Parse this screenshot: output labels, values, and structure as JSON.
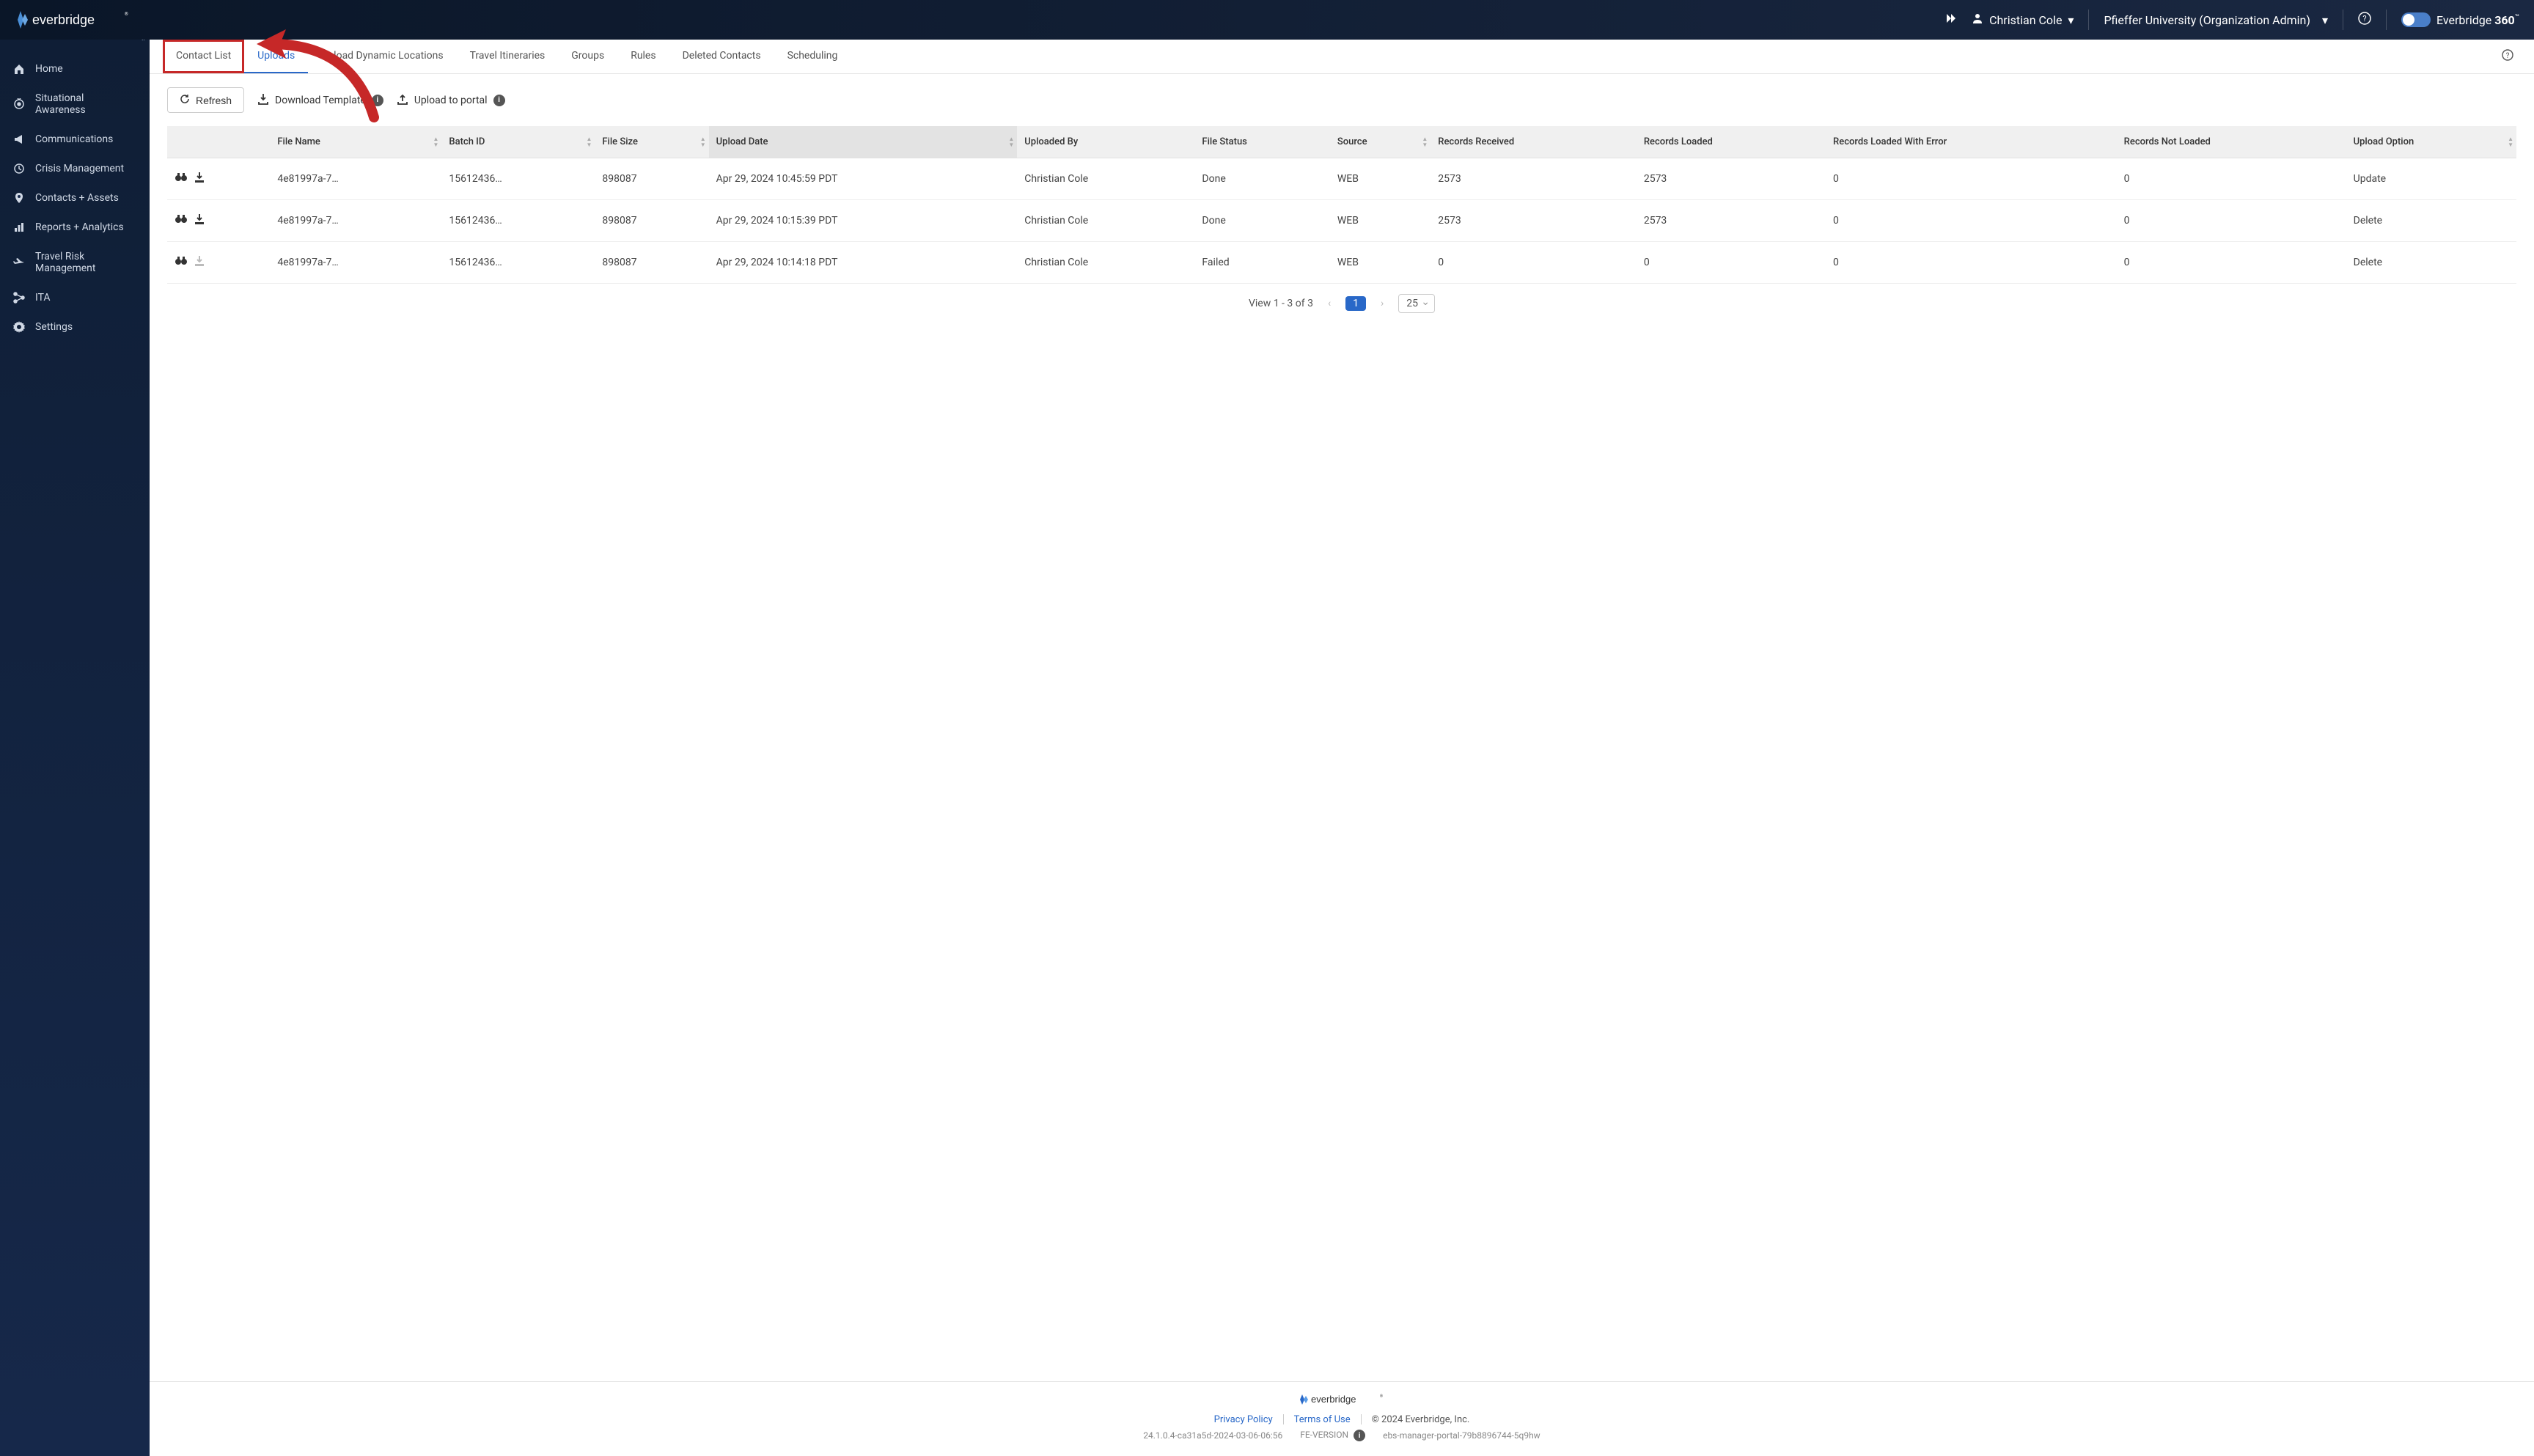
{
  "header": {
    "user_name": "Christian Cole",
    "org_label": "Pfieffer University (Organization Admin)",
    "brand_prefix": "Everbridge ",
    "brand_suffix": "360",
    "brand_tm": "™"
  },
  "sidebar": {
    "items": [
      {
        "label": "Home",
        "icon": "home-icon"
      },
      {
        "label": "Situational Awareness",
        "icon": "eye-icon"
      },
      {
        "label": "Communications",
        "icon": "megaphone-icon"
      },
      {
        "label": "Crisis Management",
        "icon": "clock-icon"
      },
      {
        "label": "Contacts + Assets",
        "icon": "pin-icon"
      },
      {
        "label": "Reports + Analytics",
        "icon": "chart-icon"
      },
      {
        "label": "Travel Risk Management",
        "icon": "plane-icon"
      },
      {
        "label": "ITA",
        "icon": "network-icon"
      },
      {
        "label": "Settings",
        "icon": "gear-icon"
      }
    ]
  },
  "tabs": [
    {
      "label": "Contact List",
      "annotated": true
    },
    {
      "label": "Uploads",
      "active": true
    },
    {
      "label": "Upload Dynamic Locations"
    },
    {
      "label": "Travel Itineraries"
    },
    {
      "label": "Groups"
    },
    {
      "label": "Rules"
    },
    {
      "label": "Deleted Contacts"
    },
    {
      "label": "Scheduling"
    }
  ],
  "toolbar": {
    "refresh_label": "Refresh",
    "download_template_label": "Download Template",
    "upload_portal_label": "Upload to portal"
  },
  "table": {
    "columns": [
      "",
      "File Name",
      "Batch ID",
      "File Size",
      "Upload Date",
      "Uploaded By",
      "File Status",
      "Source",
      "Records Received",
      "Records Loaded",
      "Records Loaded With Error",
      "Records Not Loaded",
      "Upload Option"
    ],
    "rows": [
      {
        "file_name": "4e81997a-7…",
        "batch_id": "15612436…",
        "file_size": "898087",
        "upload_date": "Apr 29, 2024 10:45:59 PDT",
        "uploaded_by": "Christian Cole",
        "file_status": "Done",
        "source": "WEB",
        "received": "2573",
        "loaded": "2573",
        "error": "0",
        "not_loaded": "0",
        "option": "Update",
        "download_enabled": true
      },
      {
        "file_name": "4e81997a-7…",
        "batch_id": "15612436…",
        "file_size": "898087",
        "upload_date": "Apr 29, 2024 10:15:39 PDT",
        "uploaded_by": "Christian Cole",
        "file_status": "Done",
        "source": "WEB",
        "received": "2573",
        "loaded": "2573",
        "error": "0",
        "not_loaded": "0",
        "option": "Delete",
        "download_enabled": true
      },
      {
        "file_name": "4e81997a-7…",
        "batch_id": "15612436…",
        "file_size": "898087",
        "upload_date": "Apr 29, 2024 10:14:18 PDT",
        "uploaded_by": "Christian Cole",
        "file_status": "Failed",
        "source": "WEB",
        "received": "0",
        "loaded": "0",
        "error": "0",
        "not_loaded": "0",
        "option": "Delete",
        "download_enabled": false
      }
    ]
  },
  "pagination": {
    "summary": "View 1 - 3 of 3",
    "current_page": "1",
    "page_size": "25"
  },
  "footer": {
    "privacy": "Privacy Policy",
    "terms": "Terms of Use",
    "copyright": "© 2024 Everbridge, Inc.",
    "version": "24.1.0.4-ca31a5d-2024-03-06-06:56",
    "fe_label": "FE-VERSION",
    "host": "ebs-manager-portal-79b8896744-5q9hw"
  }
}
